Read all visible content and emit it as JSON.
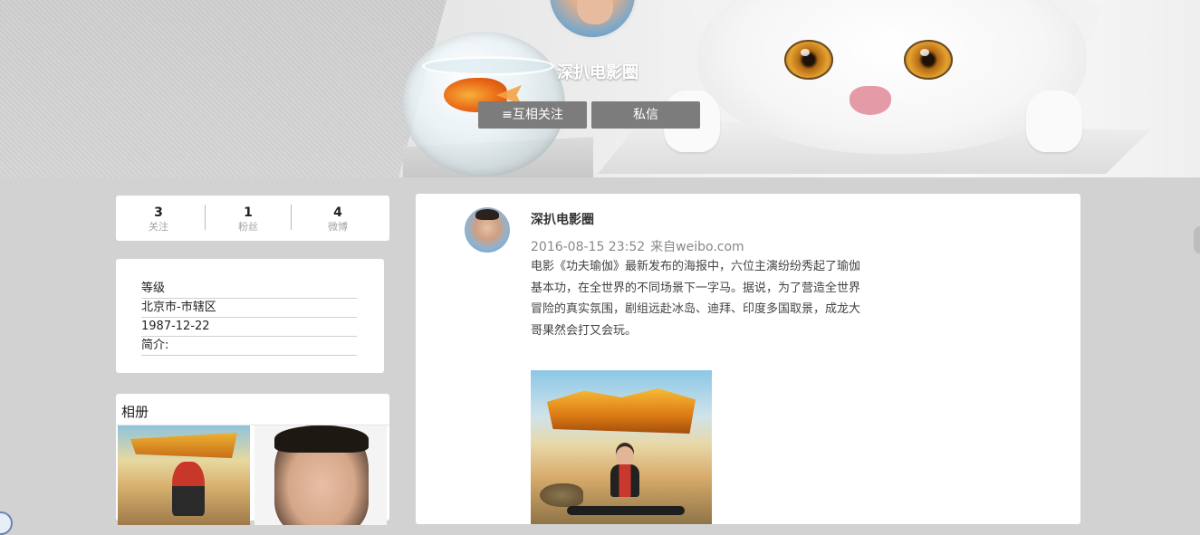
{
  "profile": {
    "name": "深扒电影圈",
    "buttons": {
      "follow_label": "≡互相关注",
      "message_label": "私信"
    }
  },
  "stats": [
    {
      "value": "3",
      "label": "关注"
    },
    {
      "value": "1",
      "label": "粉丝"
    },
    {
      "value": "4",
      "label": "微博"
    }
  ],
  "info": {
    "level": "等级",
    "location": "北京市-市辖区",
    "birthday": "1987-12-22",
    "bio": "简介:"
  },
  "album": {
    "title": "相册"
  },
  "post": {
    "author": "深扒电影圈",
    "time": "2016-08-15 23:52",
    "source": "来自weibo.com",
    "text": "电影《功夫瑜伽》最新发布的海报中，六位主演纷纷秀起了瑜伽基本功，在全世界的不同场景下一字马。据说，为了营造全世界冒险的真实氛围，剧组远赴冰岛、迪拜、印度多国取景，成龙大哥果然会打又会玩。"
  },
  "colors": {
    "page_bg": "#d2d2d2",
    "button_bg": "#7c7c7c",
    "card_bg": "#ffffff"
  }
}
